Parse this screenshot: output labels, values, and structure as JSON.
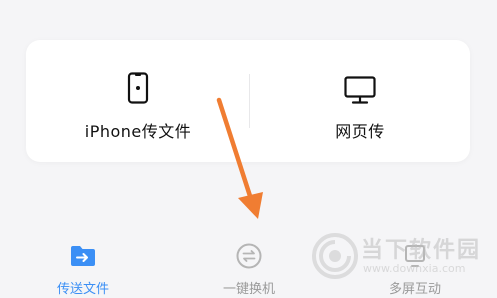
{
  "card": {
    "options": [
      {
        "label": "iPhone传文件",
        "icon": "phone-icon"
      },
      {
        "label": "网页传",
        "icon": "monitor-icon"
      }
    ]
  },
  "tabbar": {
    "tabs": [
      {
        "label": "传送文件",
        "icon": "folder-transfer-icon",
        "active": true
      },
      {
        "label": "一键换机",
        "icon": "switch-icon",
        "active": false
      },
      {
        "label": "多屏互动",
        "icon": "multi-screen-icon",
        "active": false
      }
    ]
  },
  "watermark": {
    "title": "当下软件园",
    "url": "www.downxia.com"
  },
  "colors": {
    "accent": "#3b8ff5",
    "arrow": "#f07d32",
    "inactive_text": "#9a9a9a",
    "text": "#111111"
  }
}
